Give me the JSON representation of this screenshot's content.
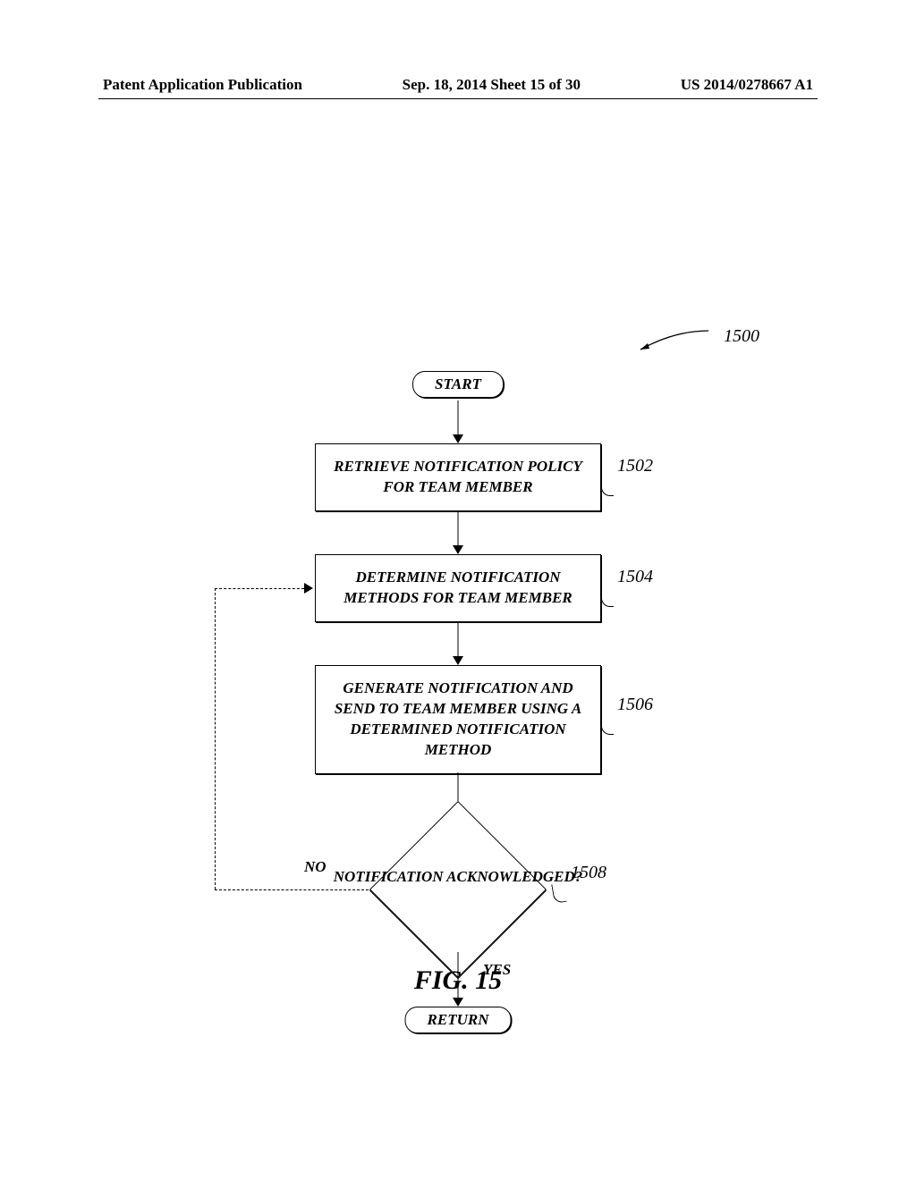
{
  "header": {
    "left": "Patent Application Publication",
    "center": "Sep. 18, 2014  Sheet 15 of 30",
    "right": "US 2014/0278667 A1"
  },
  "diagram": {
    "reference_number": "1500",
    "start": "START",
    "step_1502": {
      "text": "RETRIEVE NOTIFICATION POLICY FOR TEAM MEMBER",
      "ref": "1502"
    },
    "step_1504": {
      "text": "DETERMINE NOTIFICATION METHODS FOR TEAM MEMBER",
      "ref": "1504"
    },
    "step_1506": {
      "text": "GENERATE NOTIFICATION AND SEND TO TEAM MEMBER USING A DETERMINED NOTIFICATION METHOD",
      "ref": "1506"
    },
    "decision_1508": {
      "text": "NOTIFICATION ACKNOWLEDGED?",
      "ref": "1508",
      "no": "NO",
      "yes": "YES"
    },
    "return": "RETURN"
  },
  "figure_label": "FIG. 15"
}
